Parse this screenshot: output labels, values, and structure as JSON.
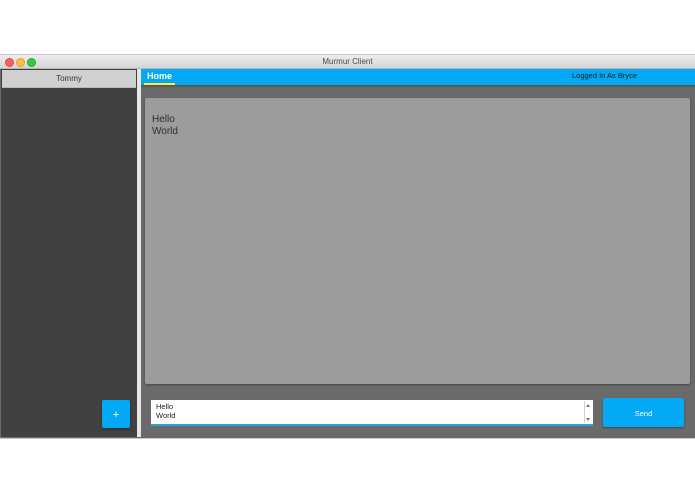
{
  "window": {
    "title": "Murmur Client"
  },
  "sidebar": {
    "contacts": [
      {
        "name": "Tommy"
      }
    ],
    "add_button_label": "+"
  },
  "header": {
    "tab_label": "Home",
    "status_text": "Logged In As Bryce"
  },
  "conversation": {
    "message_text": "Hello\nWorld"
  },
  "composer": {
    "value": "Hello\nWorld",
    "send_label": "Send"
  },
  "colors": {
    "accent": "#03a9f4",
    "tab_indicator": "#ffeb3b",
    "sidebar_bg": "#414141",
    "message_panel_bg": "#9c9c9c"
  }
}
